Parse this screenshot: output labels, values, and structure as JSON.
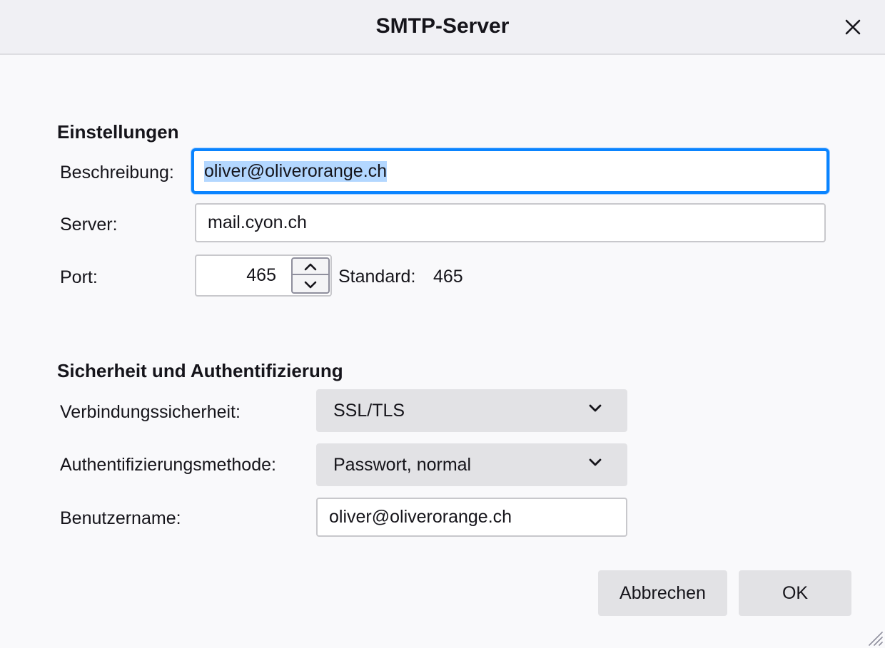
{
  "dialog": {
    "title": "SMTP-Server",
    "close_icon": "close-icon"
  },
  "settings": {
    "heading": "Einstellungen",
    "description_label": "Beschreibung:",
    "description_value": "oliver@oliverorange.ch",
    "server_label": "Server:",
    "server_value": "mail.cyon.ch",
    "port_label": "Port:",
    "port_value": "465",
    "default_label": "Standard:",
    "default_value": "465"
  },
  "security": {
    "heading": "Sicherheit und Authentifizierung",
    "connection_label": "Verbindungssicherheit:",
    "connection_value": "SSL/TLS",
    "auth_label": "Authentifizierungsmethode:",
    "auth_value": "Passwort, normal",
    "username_label": "Benutzername:",
    "username_value": "oliver@oliverorange.ch"
  },
  "buttons": {
    "cancel": "Abbrechen",
    "ok": "OK"
  },
  "colors": {
    "focus_ring": "#0a84ff",
    "selection": "#b3d7ff",
    "button_bg": "#e2e2e5"
  }
}
